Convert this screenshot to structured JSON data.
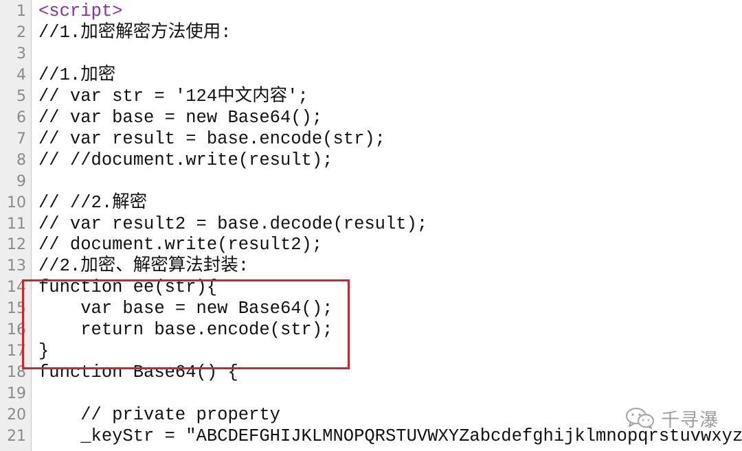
{
  "editor": {
    "lines": [
      {
        "n": "1",
        "text": "<script>",
        "kind": "tag"
      },
      {
        "n": "2",
        "text": "//1.加密解密方法使用:"
      },
      {
        "n": "3",
        "text": ""
      },
      {
        "n": "4",
        "text": "//1.加密"
      },
      {
        "n": "5",
        "text": "// var str = '124中文内容';"
      },
      {
        "n": "6",
        "text": "// var base = new Base64();"
      },
      {
        "n": "7",
        "text": "// var result = base.encode(str);"
      },
      {
        "n": "8",
        "text": "// //document.write(result);"
      },
      {
        "n": "9",
        "text": ""
      },
      {
        "n": "10",
        "text": "// //2.解密"
      },
      {
        "n": "11",
        "text": "// var result2 = base.decode(result);"
      },
      {
        "n": "12",
        "text": "// document.write(result2);"
      },
      {
        "n": "13",
        "text": "//2.加密、解密算法封装:"
      },
      {
        "n": "14",
        "text": "function ee(str){"
      },
      {
        "n": "15",
        "text": "    var base = new Base64();"
      },
      {
        "n": "16",
        "text": "    return base.encode(str);"
      },
      {
        "n": "17",
        "text": "}"
      },
      {
        "n": "18",
        "text": "function Base64() {"
      },
      {
        "n": "19",
        "text": ""
      },
      {
        "n": "20",
        "text": "    // private property"
      },
      {
        "n": "21",
        "text": "    _keyStr = \"ABCDEFGHIJKLMNOPQRSTUVWXYZabcdefghijklmnopqrstuvwxyz"
      }
    ]
  },
  "highlight": {
    "color": "#d2232a"
  },
  "watermark": {
    "text": "千寻瀑",
    "icon": "wechat-icon"
  }
}
